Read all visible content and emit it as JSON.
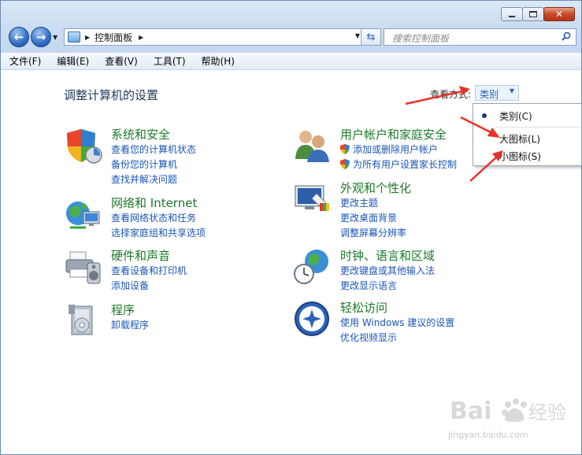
{
  "window": {
    "controls": {
      "minimize_icon": "minimize-icon",
      "maximize_icon": "maximize-icon",
      "close_label": "✕"
    }
  },
  "navbar": {
    "back_label": "←",
    "forward_label": "→",
    "address_text": "控制面板",
    "search_placeholder": "搜索控制面板"
  },
  "menu": [
    "文件(F)",
    "编辑(E)",
    "查看(V)",
    "工具(T)",
    "帮助(H)"
  ],
  "page": {
    "title": "调整计算机的设置",
    "view_label": "查看方式:",
    "view_value": "类别"
  },
  "categories": [
    {
      "title": "系统和安全",
      "links": [
        "查看您的计算机状态",
        "备份您的计算机",
        "查找并解决问题"
      ]
    },
    {
      "title": "网络和 Internet",
      "links": [
        "查看网络状态和任务",
        "选择家庭组和共享选项"
      ]
    },
    {
      "title": "硬件和声音",
      "links": [
        "查看设备和打印机",
        "添加设备"
      ]
    },
    {
      "title": "程序",
      "links": [
        "卸载程序"
      ]
    },
    {
      "title": "用户帐户和家庭安全",
      "links": [
        "添加或删除用户帐户",
        "为所有用户设置家长控制"
      ]
    },
    {
      "title": "外观和个性化",
      "links": [
        "更改主题",
        "更改桌面背景",
        "调整屏幕分辨率"
      ]
    },
    {
      "title": "时钟、语言和区域",
      "links": [
        "更改键盘或其他输入法",
        "更改显示语言"
      ]
    },
    {
      "title": "轻松访问",
      "links": [
        "使用 Windows 建议的设置",
        "优化视频显示"
      ]
    }
  ],
  "view_menu": {
    "items": [
      "类别(C)",
      "大图标(L)",
      "小图标(S)"
    ],
    "selected": "类别(C)"
  },
  "watermark": {
    "text": "jingyan.baidu.com"
  },
  "colors": {
    "link": "#1a55b8",
    "category_title": "#1c7a28",
    "arrow": "#e8322a"
  }
}
